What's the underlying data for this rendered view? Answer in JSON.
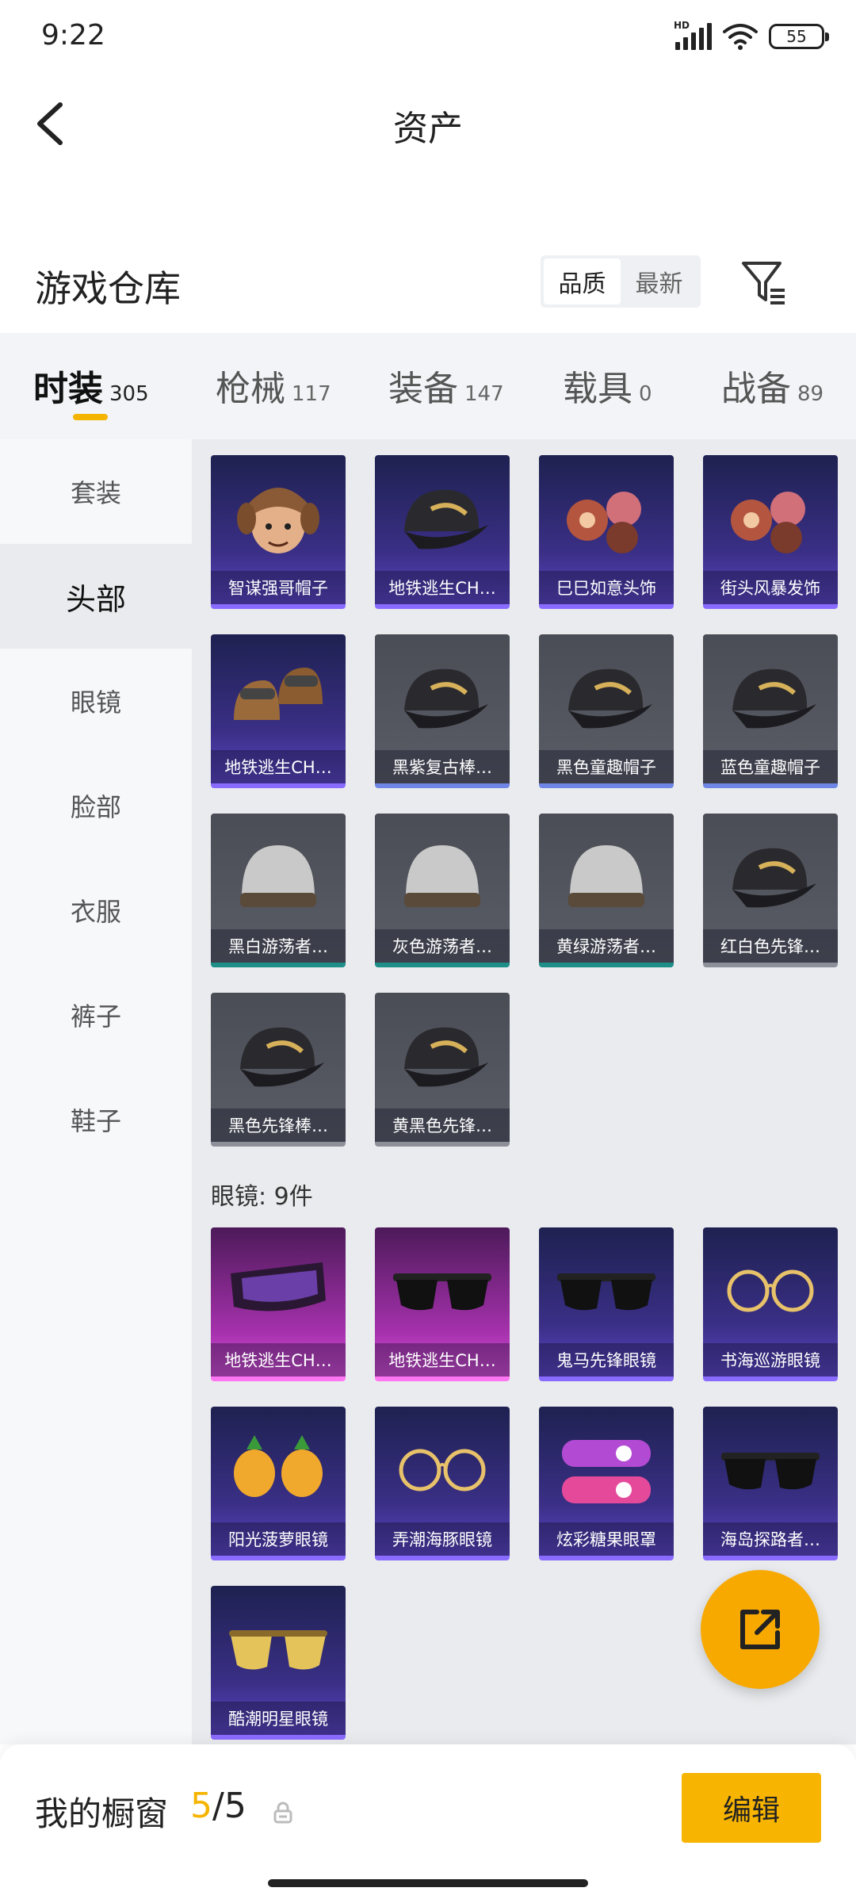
{
  "status": {
    "time": "9:22",
    "hd": "HD",
    "battery": "55"
  },
  "appbar": {
    "title": "资产"
  },
  "warehouse": {
    "title": "游戏仓库",
    "sort_options": [
      "品质",
      "最新"
    ],
    "active_sort": "品质"
  },
  "tabs": [
    {
      "label": "时装",
      "count": "305"
    },
    {
      "label": "枪械",
      "count": "117"
    },
    {
      "label": "装备",
      "count": "147"
    },
    {
      "label": "载具",
      "count": "0"
    },
    {
      "label": "战备",
      "count": "89"
    }
  ],
  "sidebar": {
    "items": [
      "套装",
      "头部",
      "眼镜",
      "脸部",
      "衣服",
      "裤子",
      "鞋子"
    ],
    "active": "头部"
  },
  "head_items": [
    {
      "name": "智谋强哥帽子",
      "rarity": "purple",
      "icon": "fur-hat-icon"
    },
    {
      "name": "地铁逃生CH…",
      "rarity": "purple",
      "icon": "cap-icon"
    },
    {
      "name": "巳巳如意头饰",
      "rarity": "purple",
      "icon": "headwear-icon"
    },
    {
      "name": "街头风暴发饰",
      "rarity": "purple",
      "icon": "headwear-icon"
    },
    {
      "name": "地铁逃生CH…",
      "rarity": "purple",
      "icon": "helmet-goggles-icon"
    },
    {
      "name": "黑紫复古棒…",
      "rarity": "blue",
      "icon": "cap-icon"
    },
    {
      "name": "黑色童趣帽子",
      "rarity": "blue",
      "icon": "cap-icon"
    },
    {
      "name": "蓝色童趣帽子",
      "rarity": "blue",
      "icon": "cap-icon"
    },
    {
      "name": "黑白游荡者…",
      "rarity": "teal",
      "icon": "beanie-icon"
    },
    {
      "name": "灰色游荡者…",
      "rarity": "teal",
      "icon": "beanie-icon"
    },
    {
      "name": "黄绿游荡者…",
      "rarity": "teal",
      "icon": "beanie-icon"
    },
    {
      "name": "红白色先锋…",
      "rarity": "none",
      "icon": "cap-icon"
    },
    {
      "name": "黑色先锋棒…",
      "rarity": "none",
      "icon": "cap-icon"
    },
    {
      "name": "黄黑色先锋…",
      "rarity": "none",
      "icon": "cap-icon"
    }
  ],
  "glasses_label": "眼镜: 9件",
  "glasses_items": [
    {
      "name": "地铁逃生CH…",
      "rarity": "pink",
      "icon": "goggles-icon"
    },
    {
      "name": "地铁逃生CH…",
      "rarity": "pink",
      "icon": "sunglasses-icon"
    },
    {
      "name": "鬼马先锋眼镜",
      "rarity": "purple",
      "icon": "sunglasses-icon"
    },
    {
      "name": "书海巡游眼镜",
      "rarity": "purple",
      "icon": "round-glasses-icon"
    },
    {
      "name": "阳光菠萝眼镜",
      "rarity": "purple",
      "icon": "pineapple-glasses-icon"
    },
    {
      "name": "弄潮海豚眼镜",
      "rarity": "purple",
      "icon": "round-glasses-icon"
    },
    {
      "name": "炫彩糖果眼罩",
      "rarity": "purple",
      "icon": "eye-mask-icon"
    },
    {
      "name": "海岛探路者…",
      "rarity": "purple",
      "icon": "sunglasses-icon"
    },
    {
      "name": "酷潮明星眼镜",
      "rarity": "purple",
      "icon": "aviator-icon"
    }
  ],
  "showcase": {
    "title": "我的橱窗",
    "used": "5",
    "sep": "/",
    "total": "5"
  },
  "edit_label": "编辑",
  "colors": {
    "accent": "#f5b400",
    "purple_rarity": "#8a6bff",
    "pink_rarity": "#ff76f2"
  }
}
